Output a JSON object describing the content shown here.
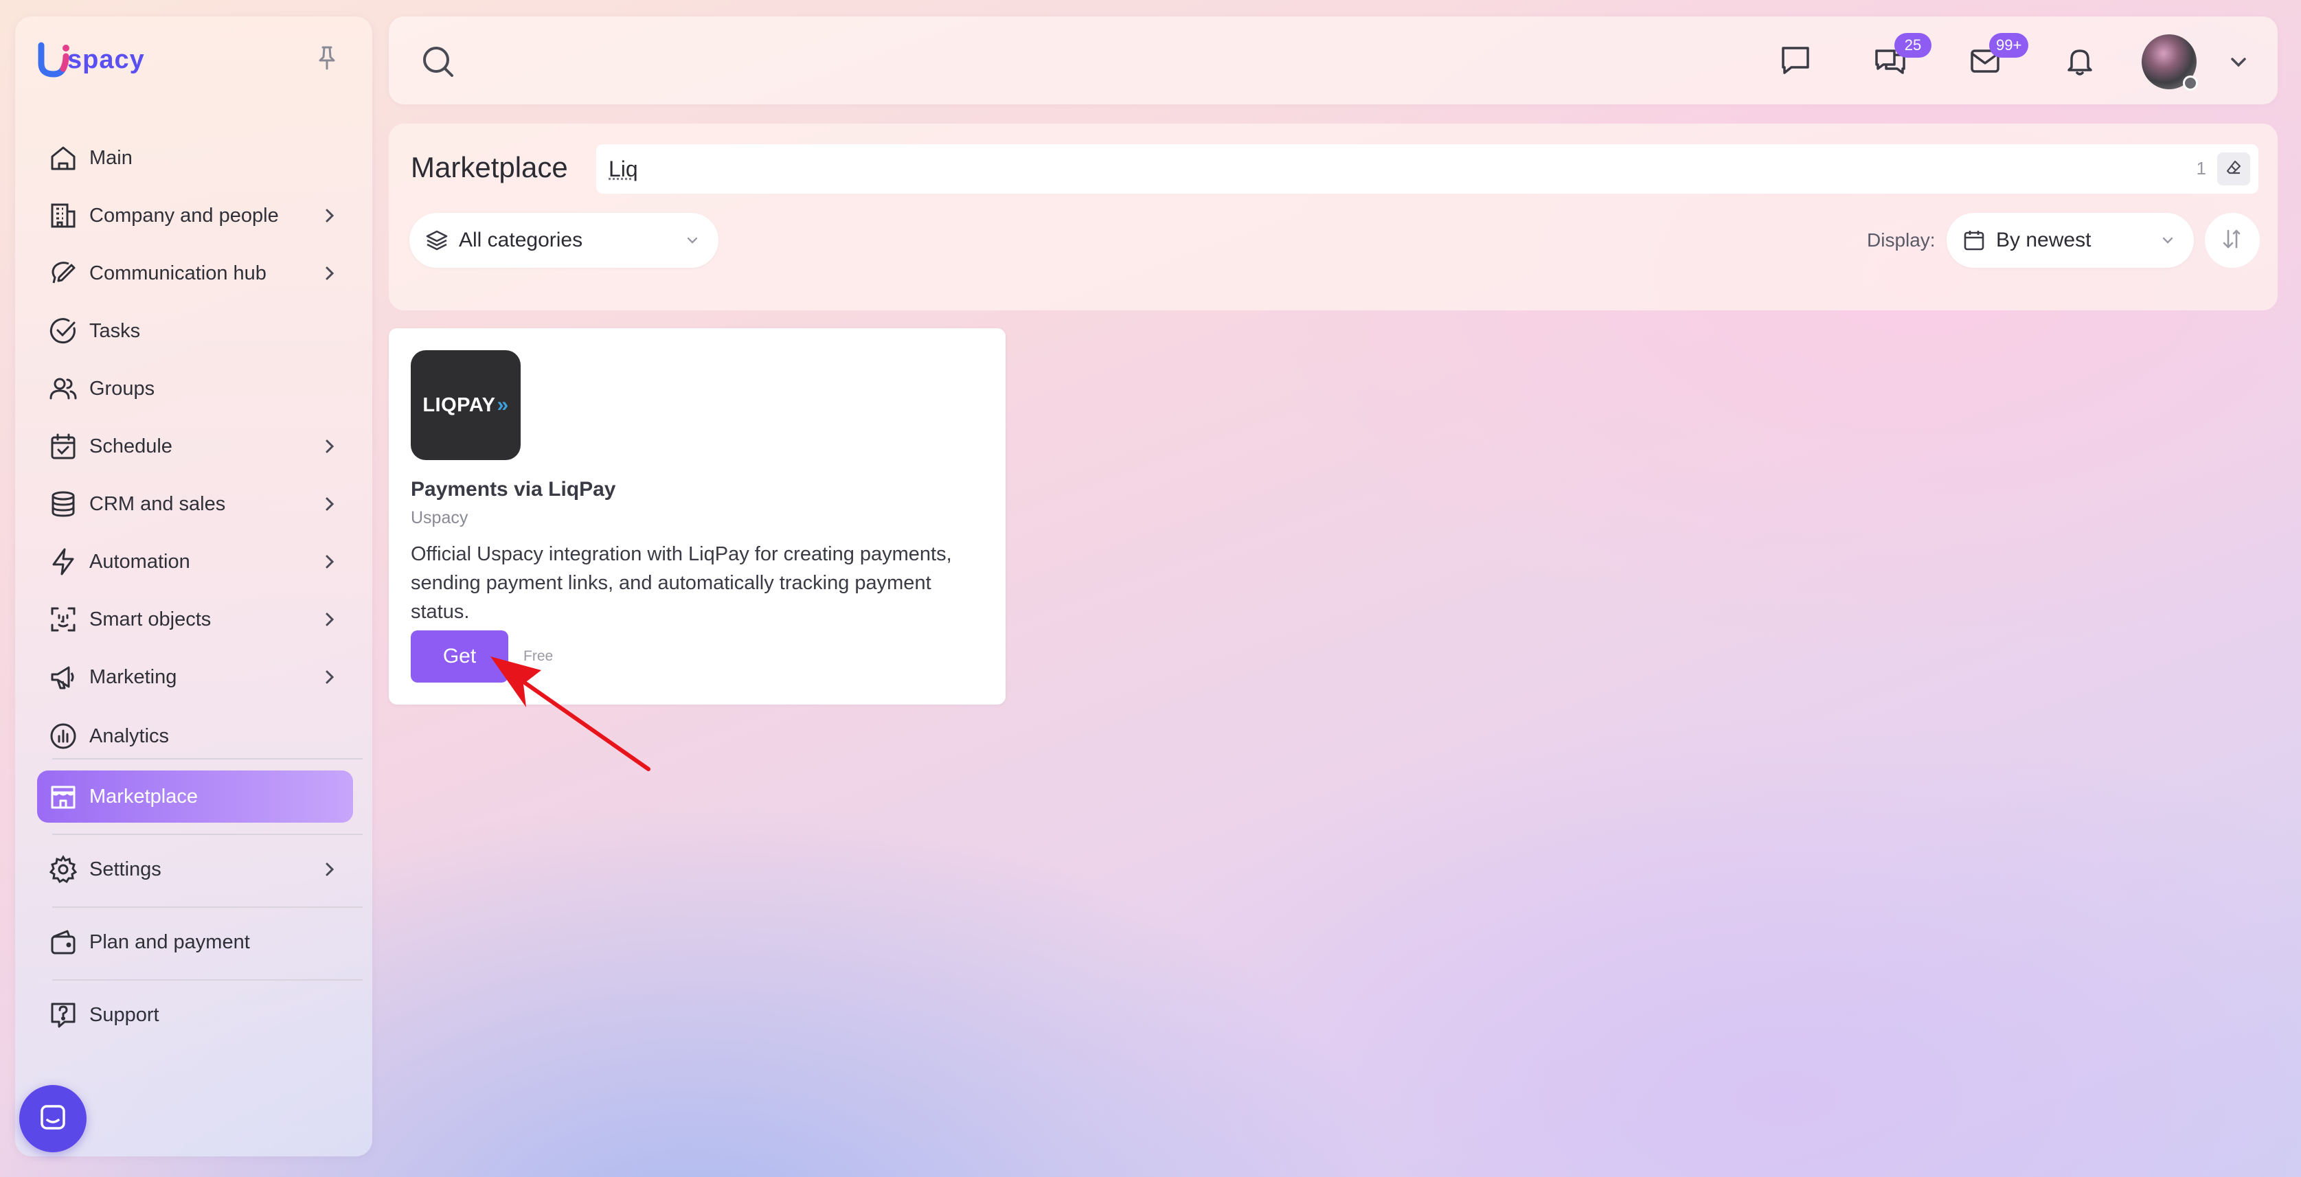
{
  "brand": {
    "name": "spacy",
    "accent": "#8e5cf2"
  },
  "sidebar": {
    "items": [
      {
        "label": "Main",
        "icon": "home-icon",
        "chevron": false
      },
      {
        "label": "Company and people",
        "icon": "building-icon",
        "chevron": true
      },
      {
        "label": "Communication hub",
        "icon": "chat-edit-icon",
        "chevron": true
      },
      {
        "label": "Tasks",
        "icon": "check-circle-icon",
        "chevron": false
      },
      {
        "label": "Groups",
        "icon": "users-icon",
        "chevron": false
      },
      {
        "label": "Schedule",
        "icon": "calendar-check-icon",
        "chevron": true
      },
      {
        "label": "CRM and sales",
        "icon": "coins-icon",
        "chevron": true
      },
      {
        "label": "Automation",
        "icon": "lightning-icon",
        "chevron": true
      },
      {
        "label": "Smart objects",
        "icon": "scan-face-icon",
        "chevron": true
      },
      {
        "label": "Marketing",
        "icon": "megaphone-icon",
        "chevron": true
      },
      {
        "label": "Analytics",
        "icon": "chart-pie-icon",
        "chevron": false
      },
      {
        "label": "Marketplace",
        "icon": "store-icon",
        "chevron": false,
        "active": true
      },
      {
        "label": "Settings",
        "icon": "gear-icon",
        "chevron": true
      },
      {
        "label": "Plan and payment",
        "icon": "wallet-icon",
        "chevron": false
      },
      {
        "label": "Support",
        "icon": "help-icon",
        "chevron": false
      }
    ]
  },
  "topbar": {
    "chat_badge": "25",
    "mail_badge": "99+"
  },
  "marketplace": {
    "title": "Marketplace",
    "search_value": "Liq",
    "search_count": "1",
    "category_filter": "All categories",
    "display_label": "Display:",
    "sort_value": "By newest"
  },
  "card": {
    "logo_text": "LIQPAY",
    "logo_arrows": "»",
    "title": "Payments via LiqPay",
    "vendor": "Uspacy",
    "description": "Official Uspacy integration with LiqPay for creating payments, sending payment links, and automatically tracking payment status.",
    "get_label": "Get",
    "price": "Free"
  }
}
